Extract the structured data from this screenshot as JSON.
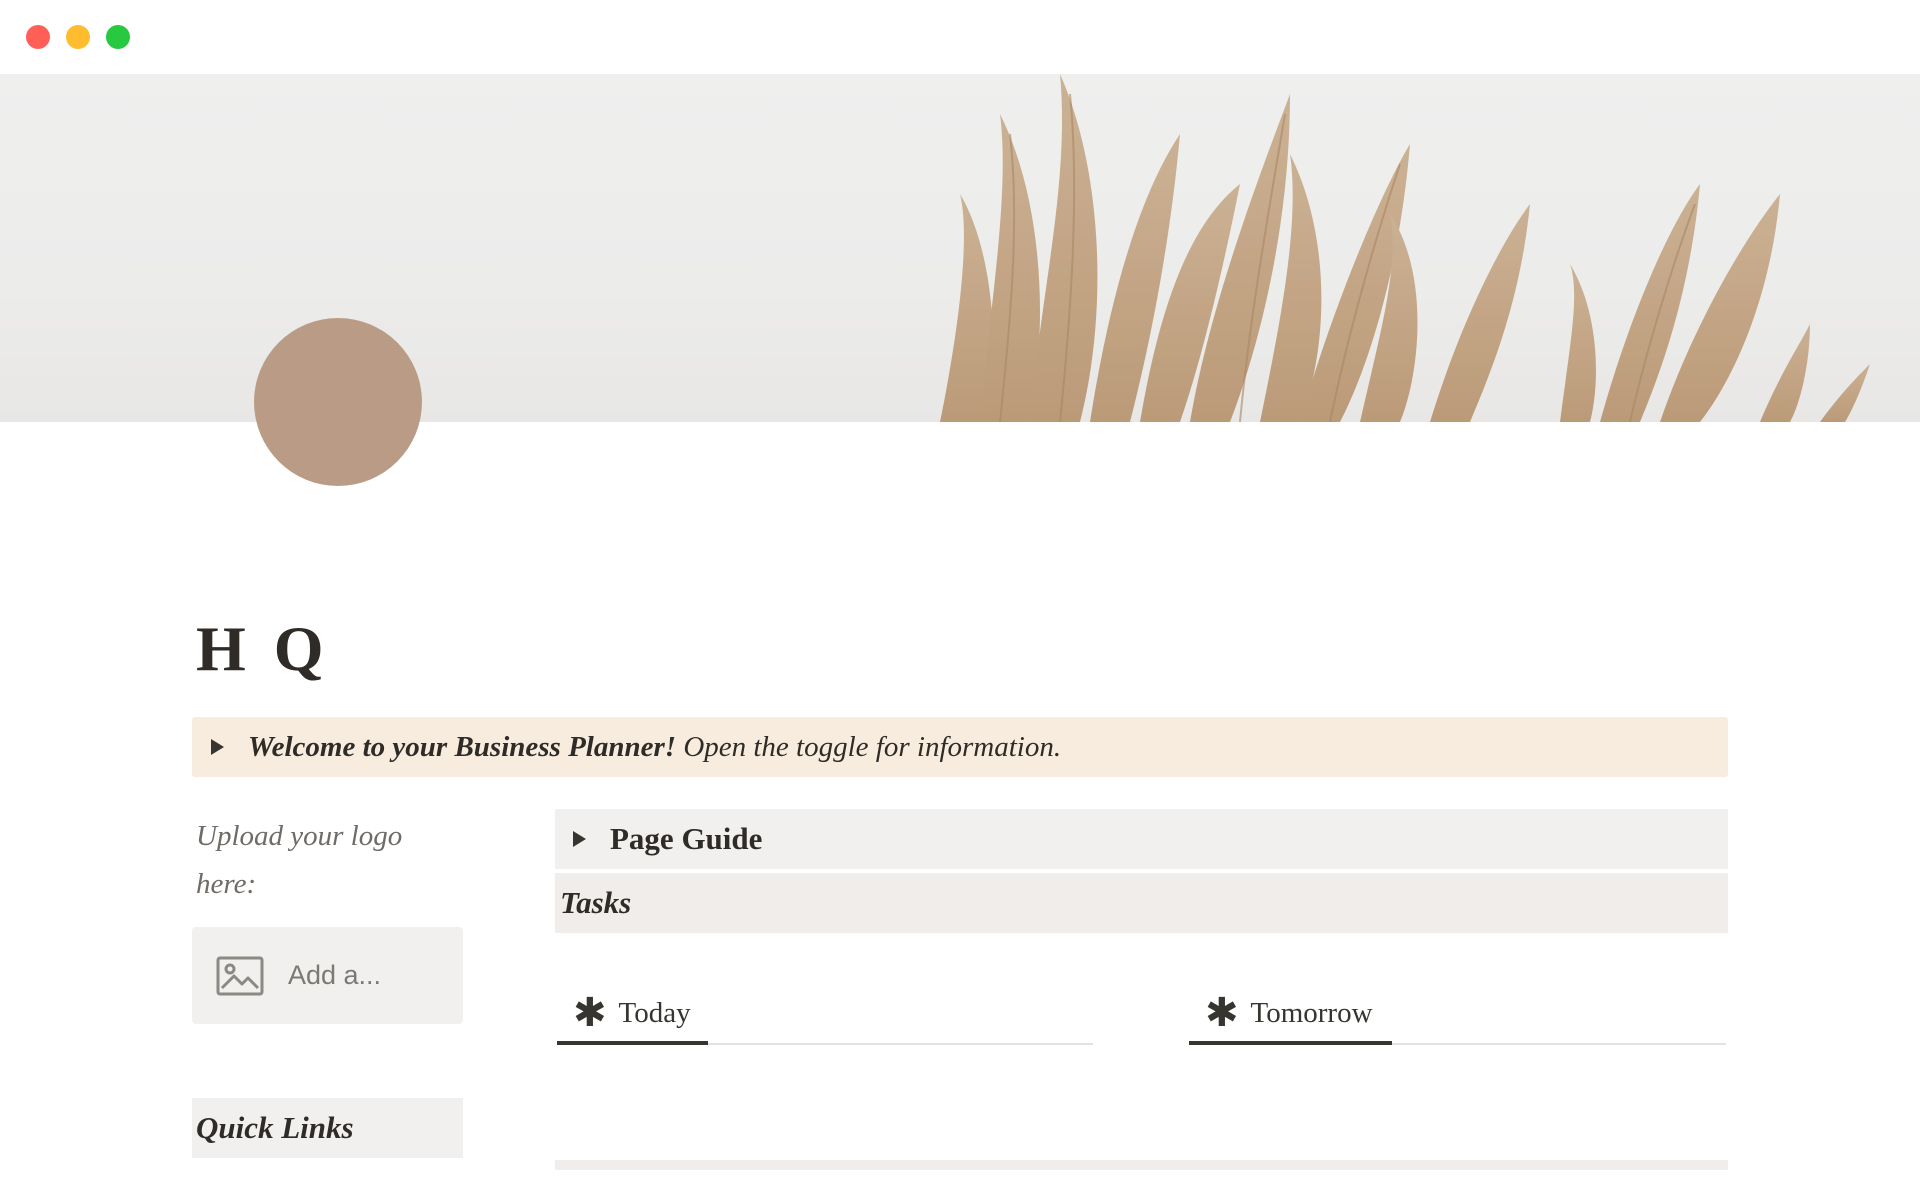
{
  "page": {
    "title": "H Q",
    "callout": {
      "bold": "Welcome to your Business Planner!",
      "text": " Open the toggle for information."
    },
    "upload_label": "Upload your logo here:",
    "add_image_label": "Add a...",
    "quick_links": "Quick Links",
    "page_guide": "Page Guide",
    "tasks_header": "Tasks",
    "tabs": [
      {
        "icon": "asterisk-icon",
        "label": "Today"
      },
      {
        "icon": "asterisk-icon",
        "label": "Tomorrow"
      }
    ]
  },
  "colors": {
    "page_icon": "#ba9c86",
    "callout_bg": "#f8ecdf",
    "block_bg": "#f1f0ee",
    "text": "#37352f"
  }
}
